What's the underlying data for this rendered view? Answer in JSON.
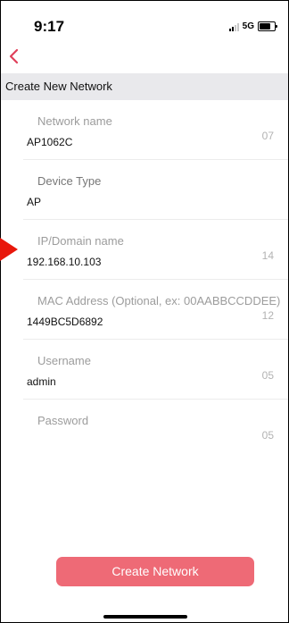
{
  "status_bar": {
    "time": "9:17",
    "network": "5G"
  },
  "header": {
    "title": "Create New Network"
  },
  "fields": [
    {
      "label": "Network name",
      "value": "AP1062C",
      "count": "07"
    },
    {
      "label": "Device Type",
      "value": "AP",
      "count": ""
    },
    {
      "label": "IP/Domain name",
      "value": "192.168.10.103",
      "count": "14"
    },
    {
      "label": "MAC Address (Optional, ex: 00AABBCCDDEE)",
      "value": "1449BC5D6892",
      "count": "12"
    },
    {
      "label": "Username",
      "value": "admin",
      "count": "05"
    },
    {
      "label": "Password",
      "value": "",
      "count": "05"
    }
  ],
  "actions": {
    "create_label": "Create Network"
  },
  "colors": {
    "accent": "#ee6a76",
    "back_icon": "#e0405a",
    "annotation_arrow": "#e8170b"
  },
  "icons": {
    "back": "chevron-left-icon",
    "signal": "signal-icon",
    "battery": "battery-icon"
  }
}
